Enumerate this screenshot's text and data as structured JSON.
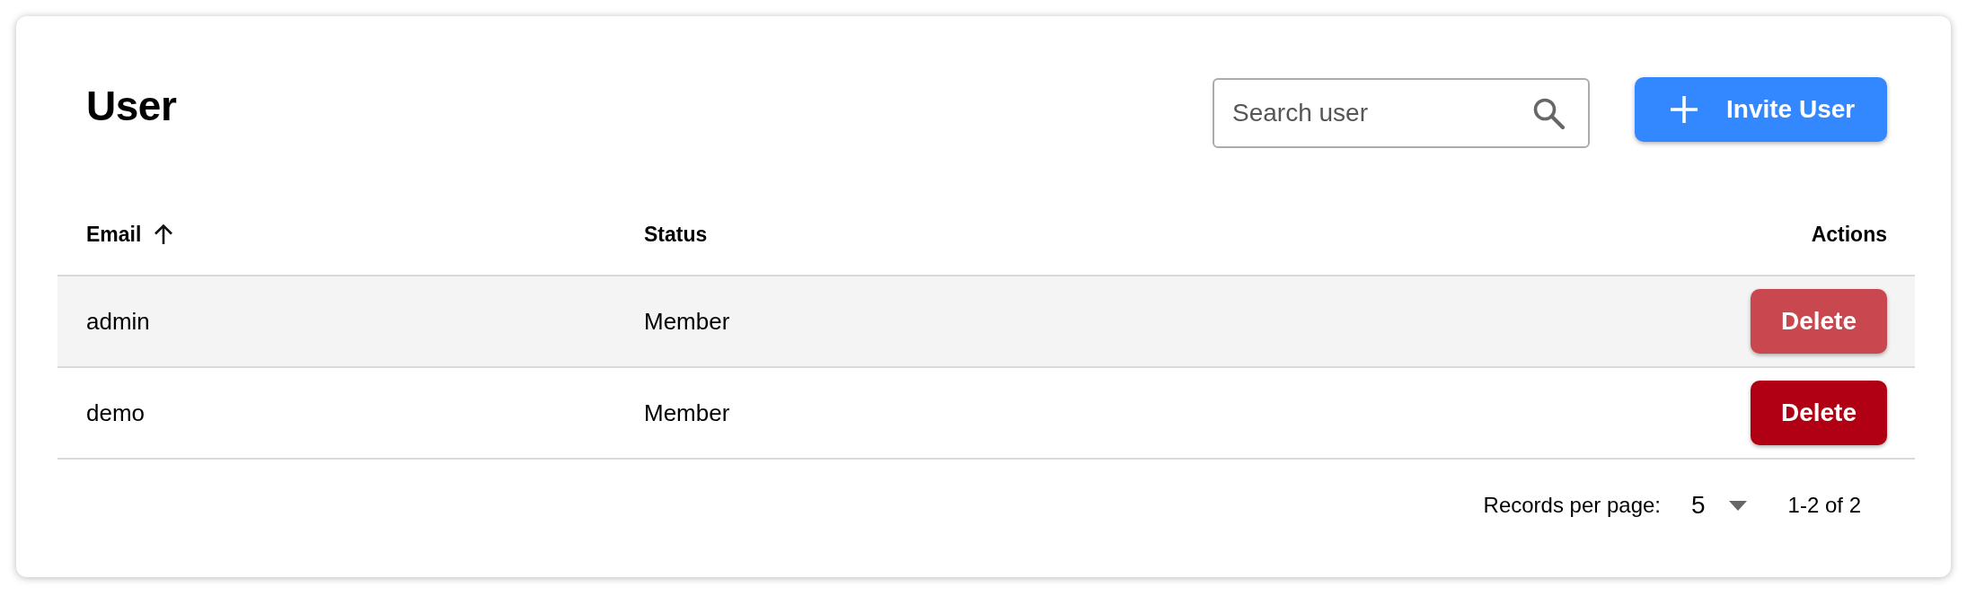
{
  "page": {
    "title": "User"
  },
  "toolbar": {
    "search": {
      "placeholder": "Search user"
    },
    "invite_button": {
      "label": "Invite User"
    }
  },
  "table": {
    "columns": [
      {
        "label": "Email",
        "sorted_ascending": true
      },
      {
        "label": "Status"
      },
      {
        "label": "Actions"
      }
    ],
    "rows": [
      {
        "email": "admin",
        "status": "Member",
        "action": "Delete",
        "hovered": true
      },
      {
        "email": "demo",
        "status": "Member",
        "action": "Delete",
        "hovered": false
      }
    ]
  },
  "pagination": {
    "label": "Records per page:",
    "page_size": "5",
    "range": "1-2 of 2"
  }
}
